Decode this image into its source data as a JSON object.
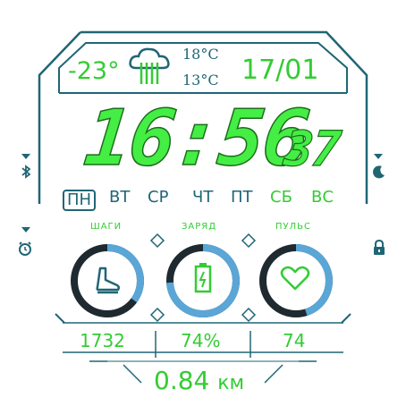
{
  "weather": {
    "current_temp": "-23°",
    "high": "18°C",
    "low": "13°C",
    "icon": "cloud-rain-icon"
  },
  "date": {
    "text": "17/01"
  },
  "time": {
    "hm": "16:56",
    "seconds": "37"
  },
  "weekdays": [
    {
      "label": "ПН",
      "active": true
    },
    {
      "label": "ВТ",
      "active": false
    },
    {
      "label": "СР",
      "active": false
    },
    {
      "label": "ЧТ",
      "active": false
    },
    {
      "label": "ПТ",
      "active": false
    },
    {
      "label": "СБ",
      "active": false
    },
    {
      "label": "ВС",
      "active": false
    }
  ],
  "metrics": {
    "steps": {
      "label": "ШАГИ",
      "value": "1732",
      "progress": 0.35,
      "icon": "foot-icon"
    },
    "battery": {
      "label": "ЗАРЯД",
      "value": "74%",
      "progress": 0.74,
      "icon": "battery-icon"
    },
    "pulse": {
      "label": "ПУЛЬС",
      "value": "74",
      "progress": 0.45,
      "icon": "heart-icon"
    }
  },
  "distance": {
    "value": "0.84",
    "unit": "км"
  },
  "colors": {
    "accent": "#33cc33",
    "frame": "#1f6675",
    "ring": "#5aa6d6",
    "track": "#1e2a30"
  },
  "side_icons": {
    "left_top": "bluetooth-icon",
    "left_bottom": "alarm-icon",
    "right_top": "moon-icon",
    "right_bottom": "lock-icon"
  }
}
